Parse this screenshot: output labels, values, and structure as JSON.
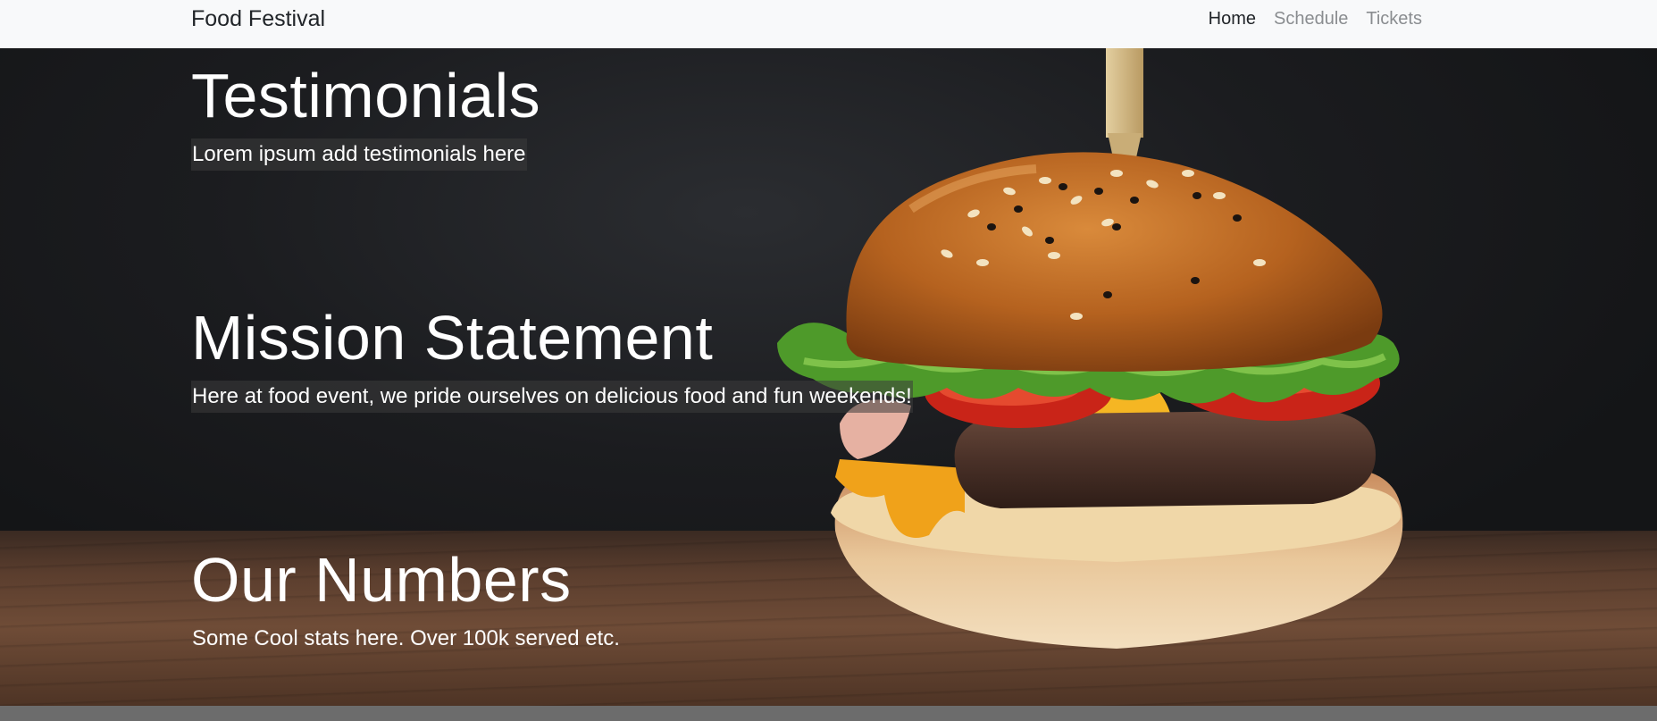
{
  "navbar": {
    "brand": "Food Festival",
    "links": [
      {
        "label": "Home",
        "active": true
      },
      {
        "label": "Schedule",
        "active": false
      },
      {
        "label": "Tickets",
        "active": false
      }
    ]
  },
  "sections": {
    "testimonials": {
      "title": "Testimonials",
      "text": "Lorem ipsum add testimonials here"
    },
    "mission": {
      "title": "Mission Statement",
      "text": "Here at food event, we pride ourselves on delicious food and fun weekends!"
    },
    "numbers": {
      "title": "Our Numbers",
      "text": "Some Cool stats here. Over 100k served etc."
    }
  },
  "colors": {
    "navbar_bg": "#f8f9fa",
    "nav_active": "#212529",
    "nav_inactive": "#8a8d90",
    "hero_text": "#ffffff",
    "footer_band": "#6c6c6c"
  }
}
